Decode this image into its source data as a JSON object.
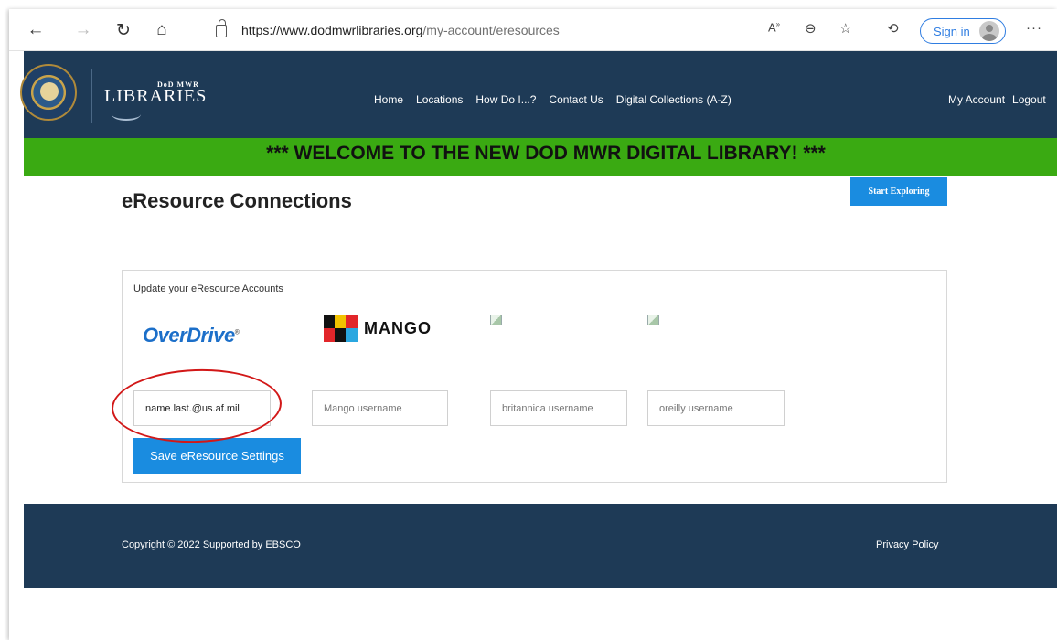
{
  "browser": {
    "url_host": "https://www.dodmwrlibraries.org",
    "url_path": "/my-account/eresources",
    "sign_in_label": "Sign in"
  },
  "site": {
    "logo_small": "DoD MWR",
    "logo_big": "LIBRARIES",
    "nav": [
      "Home",
      "Locations",
      "How Do I...?",
      "Contact Us",
      "Digital Collections (A-Z)"
    ],
    "account_nav": [
      "My Account",
      "Logout"
    ]
  },
  "banner": "*** WELCOME TO THE NEW DOD MWR DIGITAL LIBRARY! ***",
  "page": {
    "title": "eResource Connections",
    "start_button": "Start Exploring"
  },
  "panel": {
    "label": "Update your eResource Accounts",
    "overdrive_logo": "OverDrive",
    "mango_logo": "MANGO",
    "inputs": {
      "overdrive_value": "name.last.@us.af.mil",
      "mango_placeholder": "Mango username",
      "britannica_placeholder": "britannica username",
      "oreilly_placeholder": "oreilly username"
    },
    "save_button": "Save eResource Settings"
  },
  "footer": {
    "copyright": "Copyright © 2022  Supported by EBSCO",
    "privacy": "Privacy Policy"
  },
  "colors": {
    "header_bg": "#1e3a56",
    "banner_bg": "#3aaa12",
    "button_blue": "#1a8ce0",
    "highlight_red": "#d21818"
  }
}
